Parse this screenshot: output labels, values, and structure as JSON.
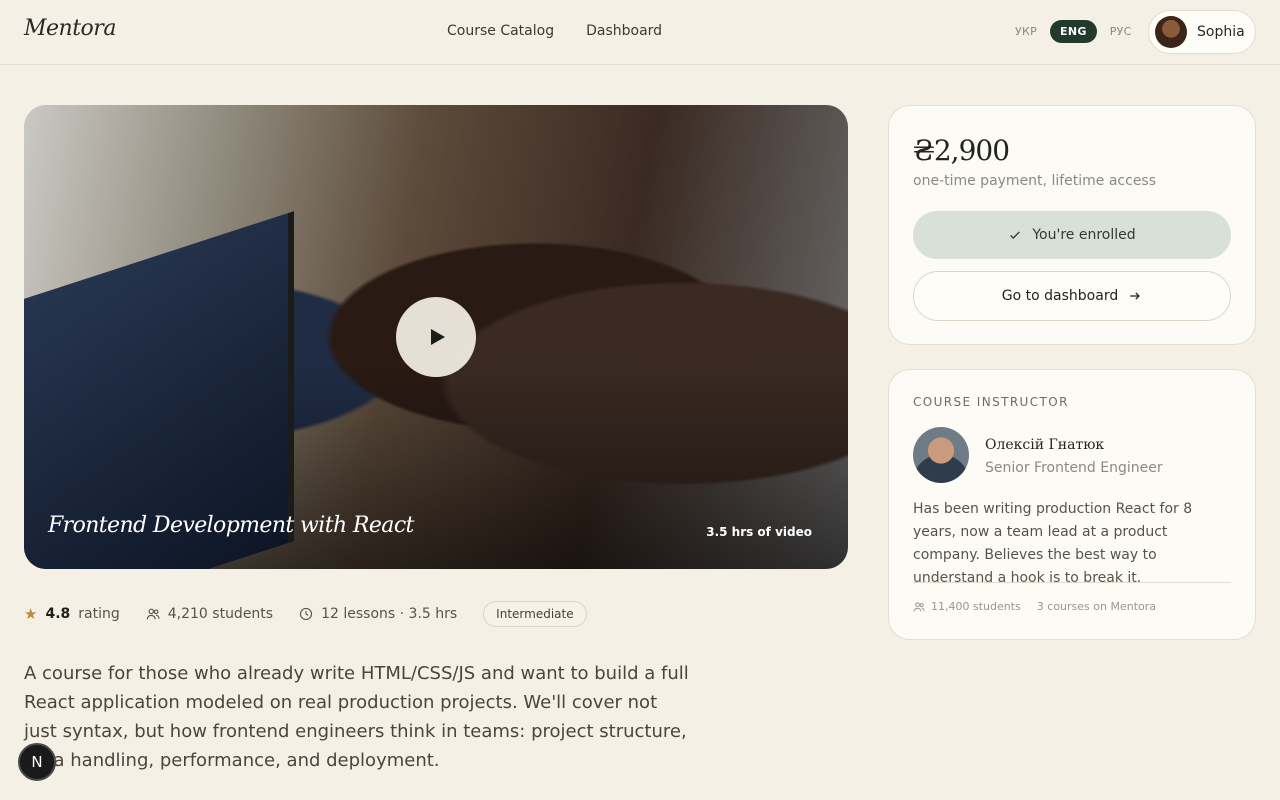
{
  "header": {
    "logo": "Mentora",
    "nav": [
      "Course Catalog",
      "Dashboard"
    ],
    "languages": [
      "УКР",
      "ENG",
      "РУС"
    ],
    "active_language": "ENG",
    "user_name": "Sophia"
  },
  "hero": {
    "title": "Frontend Development with React",
    "duration": "3.5 hrs of video"
  },
  "stats": {
    "rating_value": "4.8",
    "rating_label": "rating",
    "students": "4,210 students",
    "lessons": "12 lessons · 3.5 hrs",
    "level": "Intermediate"
  },
  "description": "A course for those who already write HTML/CSS/JS and want to build a full React application modeled on real production projects. We'll cover not just syntax, but how frontend engineers think in teams: project structure, data handling, performance, and deployment.",
  "pricing": {
    "price": "₴2,900",
    "subtitle": "one-time payment, lifetime access",
    "enrolled_label": "You're enrolled",
    "dashboard_label": "Go to dashboard"
  },
  "instructor": {
    "section_label": "COURSE INSTRUCTOR",
    "name": "Олексій Гнатюк",
    "role": "Senior Frontend Engineer",
    "bio": "Has been writing production React for 8 years, now a team lead at a product company. Believes the best way to understand a hook is to break it.",
    "students": "11,400 students",
    "courses": "3 courses on Mentora"
  },
  "fab_label": "N",
  "colors": {
    "background": "#f5f0e6",
    "accent_dark": "#213a2c",
    "enrolled_bg": "#d9e0d5",
    "star": "#c0883a"
  }
}
